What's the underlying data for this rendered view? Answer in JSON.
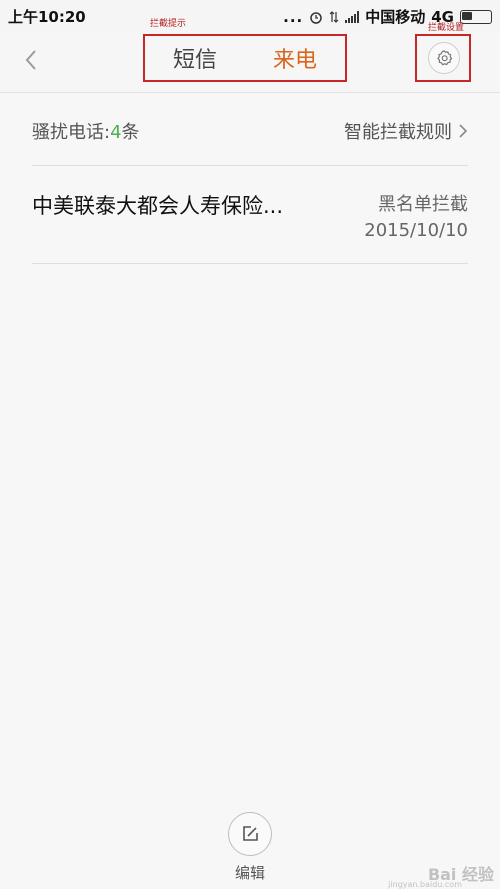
{
  "status_bar": {
    "time": "上午10:20",
    "dots": "...",
    "carrier": "中国移动",
    "network": "4G"
  },
  "header": {
    "annotation_tabs": "拦截提示",
    "annotation_settings": "拦截设置",
    "tabs": [
      {
        "label": "短信",
        "active": false
      },
      {
        "label": "来电",
        "active": true
      }
    ]
  },
  "summary": {
    "prefix": "骚扰电话:",
    "count": "4",
    "suffix": "条",
    "rules_link": "智能拦截规则"
  },
  "calls": [
    {
      "name": "中美联泰大都会人寿保险...",
      "type": "黑名单拦截",
      "date": "2015/10/10"
    }
  ],
  "footer": {
    "edit_label": "编辑"
  },
  "watermark": {
    "brand": "Bai 经验",
    "url": "jingyan.baidu.com"
  },
  "colors": {
    "accent": "#d9651a",
    "count": "#4caf50",
    "annotation": "#c62828"
  }
}
